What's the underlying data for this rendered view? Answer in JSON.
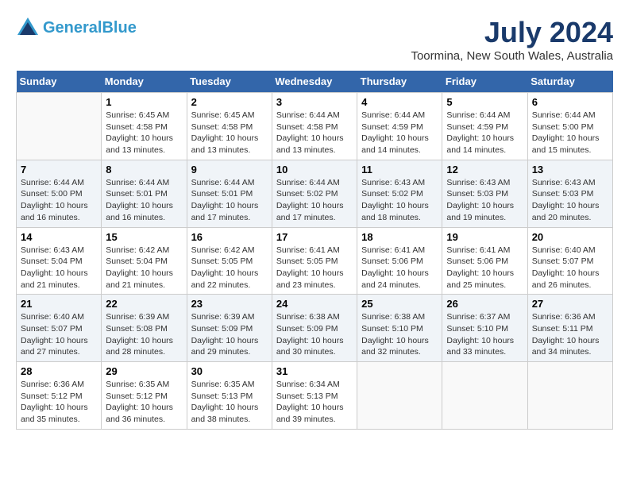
{
  "header": {
    "logo_line1": "General",
    "logo_line2": "Blue",
    "month_title": "July 2024",
    "location": "Toormina, New South Wales, Australia"
  },
  "days_of_week": [
    "Sunday",
    "Monday",
    "Tuesday",
    "Wednesday",
    "Thursday",
    "Friday",
    "Saturday"
  ],
  "weeks": [
    [
      {
        "day": "",
        "sunrise": "",
        "sunset": "",
        "daylight": ""
      },
      {
        "day": "1",
        "sunrise": "Sunrise: 6:45 AM",
        "sunset": "Sunset: 4:58 PM",
        "daylight": "Daylight: 10 hours and 13 minutes."
      },
      {
        "day": "2",
        "sunrise": "Sunrise: 6:45 AM",
        "sunset": "Sunset: 4:58 PM",
        "daylight": "Daylight: 10 hours and 13 minutes."
      },
      {
        "day": "3",
        "sunrise": "Sunrise: 6:44 AM",
        "sunset": "Sunset: 4:58 PM",
        "daylight": "Daylight: 10 hours and 13 minutes."
      },
      {
        "day": "4",
        "sunrise": "Sunrise: 6:44 AM",
        "sunset": "Sunset: 4:59 PM",
        "daylight": "Daylight: 10 hours and 14 minutes."
      },
      {
        "day": "5",
        "sunrise": "Sunrise: 6:44 AM",
        "sunset": "Sunset: 4:59 PM",
        "daylight": "Daylight: 10 hours and 14 minutes."
      },
      {
        "day": "6",
        "sunrise": "Sunrise: 6:44 AM",
        "sunset": "Sunset: 5:00 PM",
        "daylight": "Daylight: 10 hours and 15 minutes."
      }
    ],
    [
      {
        "day": "7",
        "sunrise": "Sunrise: 6:44 AM",
        "sunset": "Sunset: 5:00 PM",
        "daylight": "Daylight: 10 hours and 16 minutes."
      },
      {
        "day": "8",
        "sunrise": "Sunrise: 6:44 AM",
        "sunset": "Sunset: 5:01 PM",
        "daylight": "Daylight: 10 hours and 16 minutes."
      },
      {
        "day": "9",
        "sunrise": "Sunrise: 6:44 AM",
        "sunset": "Sunset: 5:01 PM",
        "daylight": "Daylight: 10 hours and 17 minutes."
      },
      {
        "day": "10",
        "sunrise": "Sunrise: 6:44 AM",
        "sunset": "Sunset: 5:02 PM",
        "daylight": "Daylight: 10 hours and 17 minutes."
      },
      {
        "day": "11",
        "sunrise": "Sunrise: 6:43 AM",
        "sunset": "Sunset: 5:02 PM",
        "daylight": "Daylight: 10 hours and 18 minutes."
      },
      {
        "day": "12",
        "sunrise": "Sunrise: 6:43 AM",
        "sunset": "Sunset: 5:03 PM",
        "daylight": "Daylight: 10 hours and 19 minutes."
      },
      {
        "day": "13",
        "sunrise": "Sunrise: 6:43 AM",
        "sunset": "Sunset: 5:03 PM",
        "daylight": "Daylight: 10 hours and 20 minutes."
      }
    ],
    [
      {
        "day": "14",
        "sunrise": "Sunrise: 6:43 AM",
        "sunset": "Sunset: 5:04 PM",
        "daylight": "Daylight: 10 hours and 21 minutes."
      },
      {
        "day": "15",
        "sunrise": "Sunrise: 6:42 AM",
        "sunset": "Sunset: 5:04 PM",
        "daylight": "Daylight: 10 hours and 21 minutes."
      },
      {
        "day": "16",
        "sunrise": "Sunrise: 6:42 AM",
        "sunset": "Sunset: 5:05 PM",
        "daylight": "Daylight: 10 hours and 22 minutes."
      },
      {
        "day": "17",
        "sunrise": "Sunrise: 6:41 AM",
        "sunset": "Sunset: 5:05 PM",
        "daylight": "Daylight: 10 hours and 23 minutes."
      },
      {
        "day": "18",
        "sunrise": "Sunrise: 6:41 AM",
        "sunset": "Sunset: 5:06 PM",
        "daylight": "Daylight: 10 hours and 24 minutes."
      },
      {
        "day": "19",
        "sunrise": "Sunrise: 6:41 AM",
        "sunset": "Sunset: 5:06 PM",
        "daylight": "Daylight: 10 hours and 25 minutes."
      },
      {
        "day": "20",
        "sunrise": "Sunrise: 6:40 AM",
        "sunset": "Sunset: 5:07 PM",
        "daylight": "Daylight: 10 hours and 26 minutes."
      }
    ],
    [
      {
        "day": "21",
        "sunrise": "Sunrise: 6:40 AM",
        "sunset": "Sunset: 5:07 PM",
        "daylight": "Daylight: 10 hours and 27 minutes."
      },
      {
        "day": "22",
        "sunrise": "Sunrise: 6:39 AM",
        "sunset": "Sunset: 5:08 PM",
        "daylight": "Daylight: 10 hours and 28 minutes."
      },
      {
        "day": "23",
        "sunrise": "Sunrise: 6:39 AM",
        "sunset": "Sunset: 5:09 PM",
        "daylight": "Daylight: 10 hours and 29 minutes."
      },
      {
        "day": "24",
        "sunrise": "Sunrise: 6:38 AM",
        "sunset": "Sunset: 5:09 PM",
        "daylight": "Daylight: 10 hours and 30 minutes."
      },
      {
        "day": "25",
        "sunrise": "Sunrise: 6:38 AM",
        "sunset": "Sunset: 5:10 PM",
        "daylight": "Daylight: 10 hours and 32 minutes."
      },
      {
        "day": "26",
        "sunrise": "Sunrise: 6:37 AM",
        "sunset": "Sunset: 5:10 PM",
        "daylight": "Daylight: 10 hours and 33 minutes."
      },
      {
        "day": "27",
        "sunrise": "Sunrise: 6:36 AM",
        "sunset": "Sunset: 5:11 PM",
        "daylight": "Daylight: 10 hours and 34 minutes."
      }
    ],
    [
      {
        "day": "28",
        "sunrise": "Sunrise: 6:36 AM",
        "sunset": "Sunset: 5:12 PM",
        "daylight": "Daylight: 10 hours and 35 minutes."
      },
      {
        "day": "29",
        "sunrise": "Sunrise: 6:35 AM",
        "sunset": "Sunset: 5:12 PM",
        "daylight": "Daylight: 10 hours and 36 minutes."
      },
      {
        "day": "30",
        "sunrise": "Sunrise: 6:35 AM",
        "sunset": "Sunset: 5:13 PM",
        "daylight": "Daylight: 10 hours and 38 minutes."
      },
      {
        "day": "31",
        "sunrise": "Sunrise: 6:34 AM",
        "sunset": "Sunset: 5:13 PM",
        "daylight": "Daylight: 10 hours and 39 minutes."
      },
      {
        "day": "",
        "sunrise": "",
        "sunset": "",
        "daylight": ""
      },
      {
        "day": "",
        "sunrise": "",
        "sunset": "",
        "daylight": ""
      },
      {
        "day": "",
        "sunrise": "",
        "sunset": "",
        "daylight": ""
      }
    ]
  ]
}
